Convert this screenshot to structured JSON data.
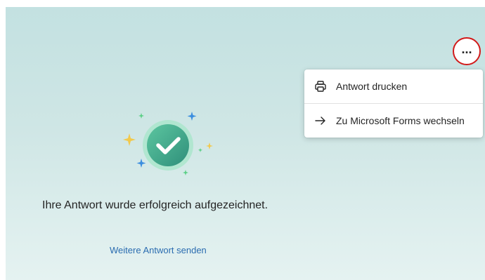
{
  "more_button": {
    "label": "...",
    "icon": "more-horizontal-icon",
    "highlight_color": "#d21a1a"
  },
  "menu": {
    "items": [
      {
        "label": "Antwort drucken",
        "icon": "printer-icon"
      },
      {
        "label": "Zu Microsoft Forms wechseln",
        "icon": "arrow-right-icon"
      }
    ]
  },
  "confirmation": {
    "message": "Ihre Antwort wurde erfolgreich aufgezeichnet.",
    "link": "Weitere Antwort senden",
    "icon": "checkmark-circle-icon"
  },
  "colors": {
    "background_top": "#c3e1e1",
    "background_bottom": "#e5f2f1",
    "link": "#2b6cb0",
    "check_circle": "#45ae8b",
    "sparkle_yellow": "#f2c94c",
    "sparkle_blue": "#3b8edf",
    "sparkle_green": "#5bcf86"
  }
}
